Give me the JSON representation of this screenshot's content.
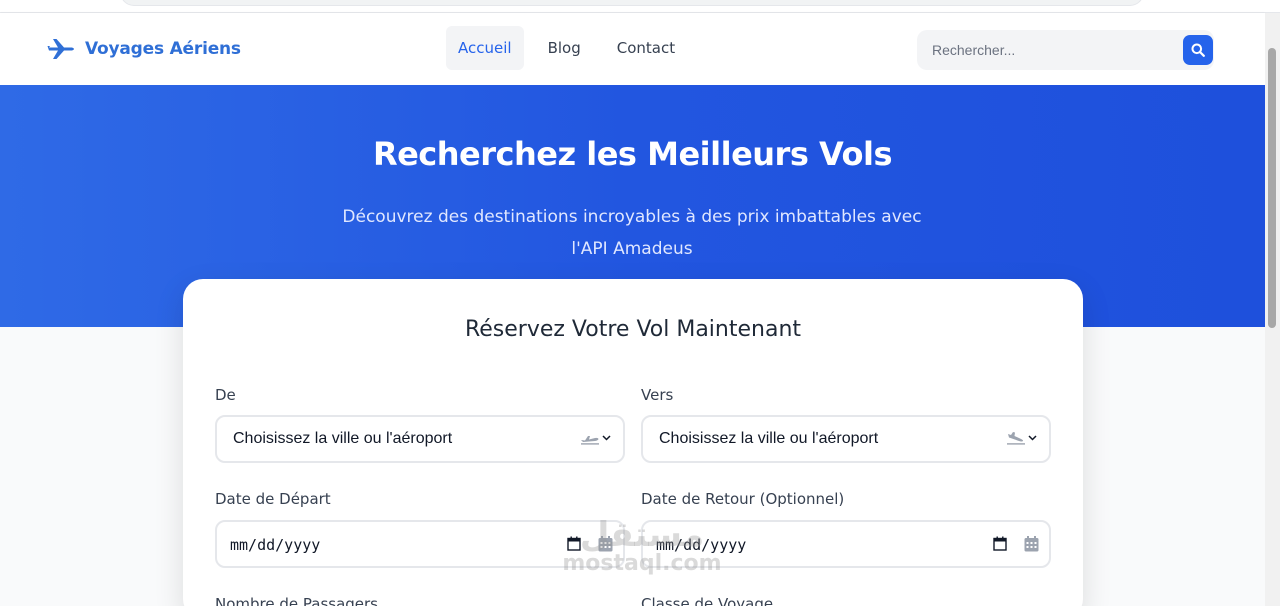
{
  "brand": {
    "name": "Voyages Aériens",
    "icon": "plane-icon"
  },
  "nav": {
    "links": [
      {
        "label": "Accueil",
        "active": true
      },
      {
        "label": "Blog",
        "active": false
      },
      {
        "label": "Contact",
        "active": false
      }
    ]
  },
  "search": {
    "placeholder": "Rechercher...",
    "icon": "search-icon"
  },
  "hero": {
    "title": "Recherchez les Meilleurs Vols",
    "subtitle": "Découvrez des destinations incroyables à des prix imbattables avec l'API Amadeus"
  },
  "form": {
    "title": "Réservez Votre Vol Maintenant",
    "from": {
      "label": "De",
      "value": "Choisissez la ville ou l'aéroport",
      "icon": "plane-departure-icon"
    },
    "to": {
      "label": "Vers",
      "value": "Choisissez la ville ou l'aéroport",
      "icon": "plane-arrival-icon"
    },
    "departure_date": {
      "label": "Date de Départ",
      "value": "mm/dd/yyyy"
    },
    "return_date": {
      "label": "Date de Retour (Optionnel)",
      "value": "mm/dd/yyyy"
    },
    "passengers": {
      "label": "Nombre de Passagers"
    },
    "class": {
      "label": "Classe de Voyage"
    }
  },
  "watermark": {
    "arabic": "مستقل",
    "latin": "mostaql.com"
  },
  "colors": {
    "primary": "#2563eb",
    "brand_text": "#2f6fd6",
    "hero_bg": "#2256e0"
  }
}
